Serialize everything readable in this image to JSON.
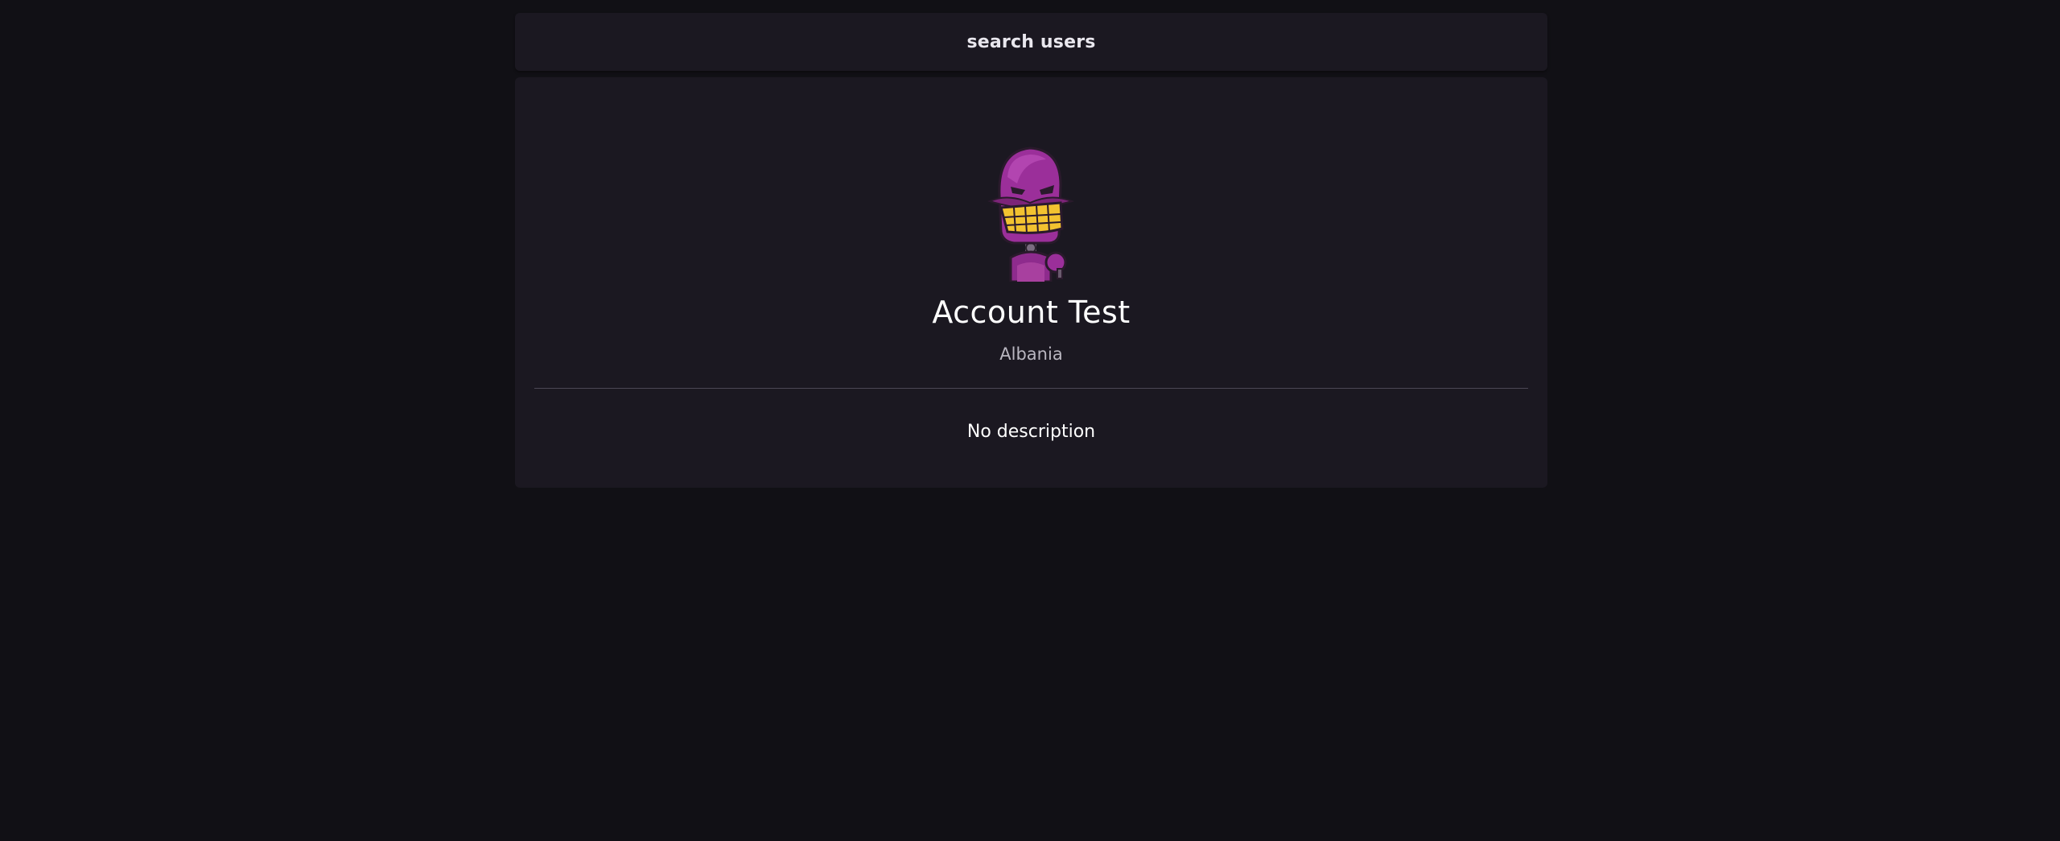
{
  "search": {
    "label": "search users"
  },
  "profile": {
    "name": "Account Test",
    "country": "Albania",
    "description": "No description",
    "avatar_icon": "purple-robot-avatar-icon"
  },
  "colors": {
    "background": "#111015",
    "card": "#1b1821",
    "avatar_purple": "#9b2f9a",
    "avatar_teeth": "#f2c230"
  }
}
